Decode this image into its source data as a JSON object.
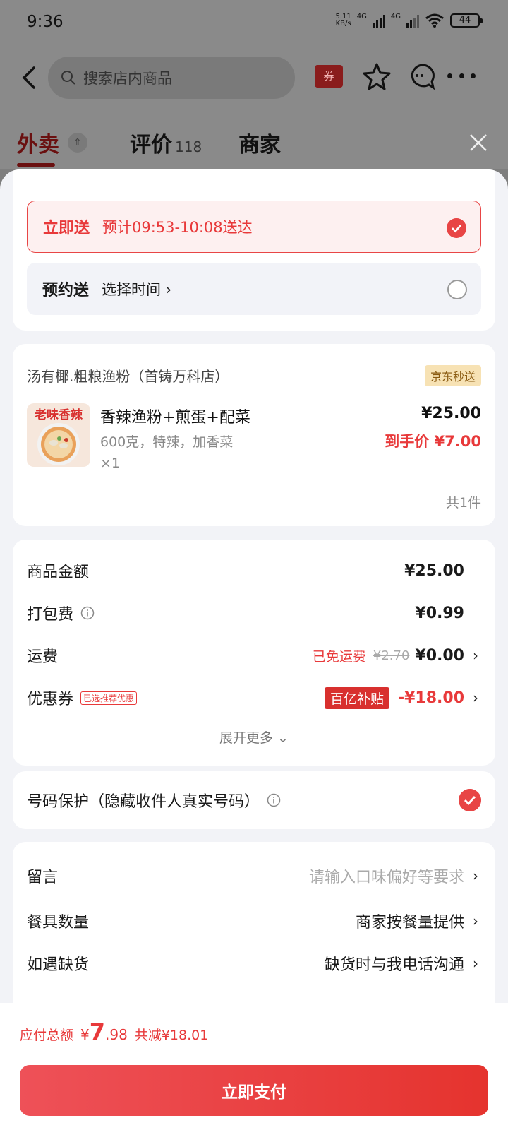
{
  "status": {
    "time": "9:36",
    "speed_top": "5.11",
    "speed_bottom": "KB/s",
    "net1": "4G",
    "net2": "4G",
    "battery": "44"
  },
  "topbar": {
    "search_placeholder": "搜索店内商品",
    "coupon_label": "券"
  },
  "tabs": {
    "waimai": "外卖",
    "review": "评价",
    "review_count": "118",
    "shop": "商家"
  },
  "delivery": {
    "now_label": "立即送",
    "now_desc": "预计09:53-10:08送达",
    "later_label": "预约送",
    "later_desc": "选择时间 ›"
  },
  "order": {
    "shop_name": "汤有椰.粗粮渔粉（首铸万科店）",
    "shop_badge": "京东秒送",
    "image_text": "老味香辣",
    "goods_name": "香辣渔粉+煎蛋+配菜",
    "goods_spec": "600克，特辣，加香菜",
    "goods_qty": "×1",
    "goods_price": "¥25.00",
    "goods_final": "到手价 ¥7.00",
    "total_count": "共1件"
  },
  "fees": {
    "goods_amount_label": "商品金额",
    "goods_amount": "¥25.00",
    "packing_label": "打包费",
    "packing": "¥0.99",
    "shipping_label": "运费",
    "shipping_free": "已免运费",
    "shipping_orig": "¥2.70",
    "shipping": "¥0.00",
    "coupon_label": "优惠券",
    "coupon_tag": "已选推荐优惠",
    "coupon_subsidy": "百亿补贴",
    "coupon_value": "-¥18.00",
    "expand": "展开更多 ⌄"
  },
  "phone_protect": {
    "label": "号码保护（隐藏收件人真实号码）"
  },
  "notes": {
    "message_label": "留言",
    "message_placeholder": "请输入口味偏好等要求",
    "tableware_label": "餐具数量",
    "tableware_value": "商家按餐量提供",
    "stockout_label": "如遇缺货",
    "stockout_value": "缺货时与我电话沟通"
  },
  "bottom": {
    "total_label": "应付总额",
    "yen": "¥",
    "total_int": "7",
    "total_dec": ".98",
    "saved": "共减¥18.01",
    "pay_button": "立即支付"
  },
  "colors": {
    "accent": "#e8393a",
    "subsidy": "#d8302e",
    "badge_bg": "#f7e2b4"
  }
}
